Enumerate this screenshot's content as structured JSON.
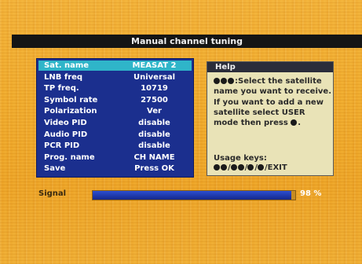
{
  "title": "Manual channel tuning",
  "settings": [
    {
      "label": "Sat. name",
      "value": "MEASAT 2",
      "selected": true
    },
    {
      "label": "LNB freq",
      "value": "Universal"
    },
    {
      "label": "TP freq.",
      "value": "10719"
    },
    {
      "label": "Symbol rate",
      "value": "27500"
    },
    {
      "label": "Polarization",
      "value": "Ver"
    },
    {
      "label": "Video PID",
      "value": "disable"
    },
    {
      "label": "Audio PID",
      "value": "disable"
    },
    {
      "label": "PCR PID",
      "value": "disable"
    },
    {
      "label": "Prog. name",
      "value": "CH NAME"
    },
    {
      "label": "Save",
      "value": "Press OK"
    }
  ],
  "help": {
    "title": "Help",
    "lines": [
      ":Select the satellite",
      "name you want to receive.",
      "If you want to add a new",
      "satellite select USER",
      "mode then press"
    ],
    "usage_label": "Usage keys:",
    "usage_exit": "/EXIT"
  },
  "signal": {
    "label": "Signal",
    "percent": 98,
    "value_text": "98 %"
  },
  "colors": {
    "panel_bg": "#1b2f8e",
    "selected_row": "#2fb5c9",
    "help_bg": "#e9e3b7",
    "title_bar": "#151515",
    "signal_fill": "#1d37a8"
  }
}
